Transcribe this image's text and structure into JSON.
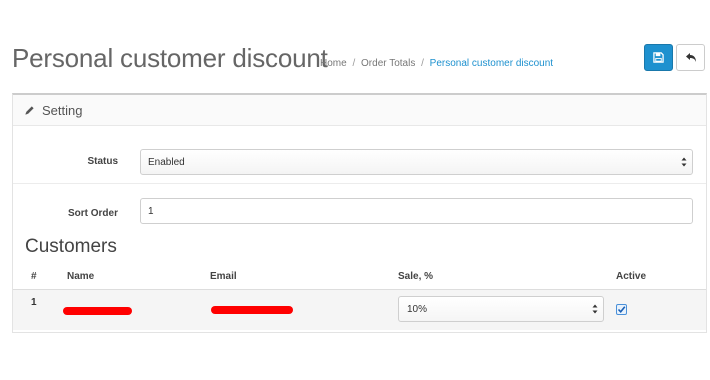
{
  "header": {
    "title": "Personal customer discount",
    "breadcrumb": [
      "Home",
      "Order Totals",
      "Personal customer discount"
    ],
    "save_icon": "save-icon",
    "back_icon": "reply-icon",
    "accent": "#1e91cf"
  },
  "panel": {
    "heading": "Setting",
    "heading_icon": "pencil-icon",
    "status_label": "Status",
    "status_value": "Enabled",
    "sort_label": "Sort Order",
    "sort_value": "1"
  },
  "customers": {
    "title": "Customers",
    "columns": [
      "#",
      "Name",
      "Email",
      "Sale, %",
      "Active"
    ],
    "rows": [
      {
        "num": "1",
        "sale": "10%",
        "active": true
      }
    ],
    "redaction_color": "#ff0000"
  }
}
